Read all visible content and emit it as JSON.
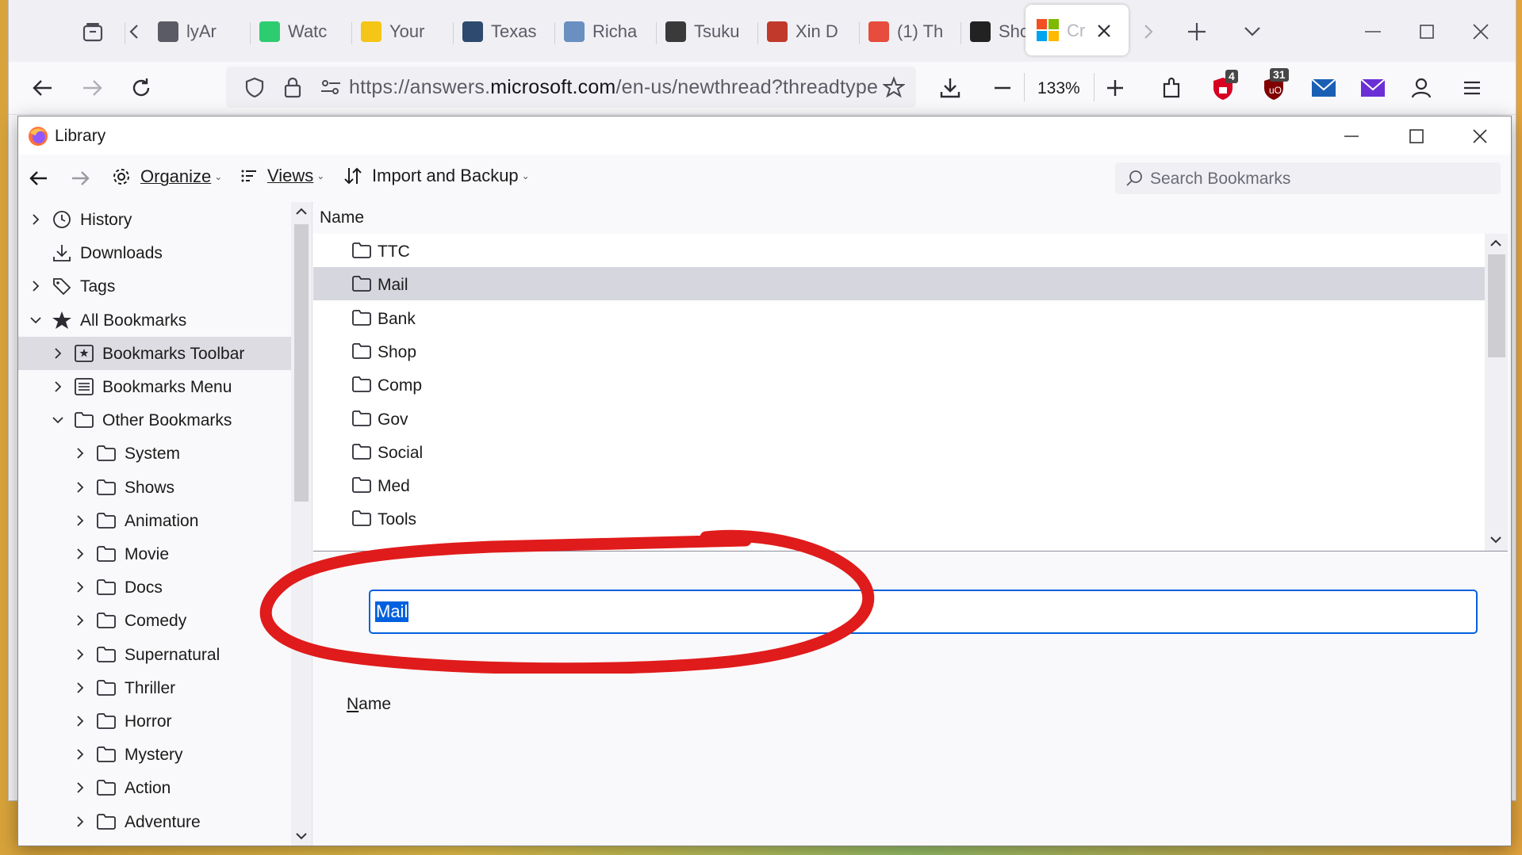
{
  "browser": {
    "tabs": [
      {
        "title": "lyAr",
        "icon": "generic-page-icon",
        "color": "#5b5b66"
      },
      {
        "title": "Watc",
        "icon": "sync-icon",
        "color": "#2ecc71"
      },
      {
        "title": "Your",
        "icon": "imdb-icon",
        "color": "#f5c518"
      },
      {
        "title": "Texas",
        "icon": "texas-icon",
        "color": "#2e4a6e"
      },
      {
        "title": "Richa",
        "icon": "fa-icon",
        "color": "#6a8fc1"
      },
      {
        "title": "Tsuku",
        "icon": "db-icon",
        "color": "#3a3a3a"
      },
      {
        "title": "Xin D",
        "icon": "planet-icon",
        "color": "#c0392b"
      },
      {
        "title": "(1) Th",
        "icon": "feather-icon",
        "color": "#e74c3c"
      },
      {
        "title": "Shoe",
        "icon": "shoe-icon",
        "color": "#222222"
      }
    ],
    "active_tab": {
      "title": "Cr",
      "icon": "microsoft-icon"
    },
    "url_prefix": "https://answers.",
    "url_domain": "microsoft.com",
    "url_suffix": "/en-us/newthread?threadtype",
    "zoom": "133%",
    "badges": {
      "shield": "4",
      "ublock": "31"
    }
  },
  "library": {
    "title": "Library",
    "toolbar": {
      "organize": "Organize",
      "views": "Views",
      "import_backup": "Import and Backup"
    },
    "search": {
      "placeholder": "Search Bookmarks"
    },
    "tree": [
      {
        "label": "History",
        "icon": "clock-icon",
        "twisty": "right",
        "level": 0
      },
      {
        "label": "Downloads",
        "icon": "download-icon",
        "twisty": "none",
        "level": 0
      },
      {
        "label": "Tags",
        "icon": "tag-icon",
        "twisty": "right",
        "level": 0
      },
      {
        "label": "All Bookmarks",
        "icon": "star-icon",
        "twisty": "down",
        "level": 0
      },
      {
        "label": "Bookmarks Toolbar",
        "icon": "bookmarks-toolbar-icon",
        "twisty": "right",
        "level": 1,
        "selected": true
      },
      {
        "label": "Bookmarks Menu",
        "icon": "bookmarks-menu-icon",
        "twisty": "right",
        "level": 1
      },
      {
        "label": "Other Bookmarks",
        "icon": "folder-icon",
        "twisty": "down",
        "level": 1
      },
      {
        "label": "System",
        "icon": "folder-icon",
        "twisty": "right",
        "level": 2
      },
      {
        "label": "Shows",
        "icon": "folder-icon",
        "twisty": "right",
        "level": 2
      },
      {
        "label": "Animation",
        "icon": "folder-icon",
        "twisty": "right",
        "level": 2
      },
      {
        "label": "Movie",
        "icon": "folder-icon",
        "twisty": "right",
        "level": 2
      },
      {
        "label": "Docs",
        "icon": "folder-icon",
        "twisty": "right",
        "level": 2
      },
      {
        "label": "Comedy",
        "icon": "folder-icon",
        "twisty": "right",
        "level": 2
      },
      {
        "label": "Supernatural",
        "icon": "folder-icon",
        "twisty": "right",
        "level": 2
      },
      {
        "label": "Thriller",
        "icon": "folder-icon",
        "twisty": "right",
        "level": 2
      },
      {
        "label": "Horror",
        "icon": "folder-icon",
        "twisty": "right",
        "level": 2
      },
      {
        "label": "Mystery",
        "icon": "folder-icon",
        "twisty": "right",
        "level": 2
      },
      {
        "label": "Action",
        "icon": "folder-icon",
        "twisty": "right",
        "level": 2
      },
      {
        "label": "Adventure",
        "icon": "folder-icon",
        "twisty": "right",
        "level": 2
      }
    ],
    "list_header": "Name",
    "list": [
      {
        "label": "TTC"
      },
      {
        "label": "Mail",
        "selected": true
      },
      {
        "label": "Bank"
      },
      {
        "label": "Shop"
      },
      {
        "label": "Comp"
      },
      {
        "label": "Gov"
      },
      {
        "label": "Social"
      },
      {
        "label": "Med"
      },
      {
        "label": "Tools"
      }
    ],
    "edit": {
      "label_accesskey": "N",
      "label_rest": "ame",
      "value": "Mail"
    }
  },
  "colors": {
    "accent": "#0060df",
    "annotation": "#e01b1b",
    "selection": "#dcdce2"
  }
}
